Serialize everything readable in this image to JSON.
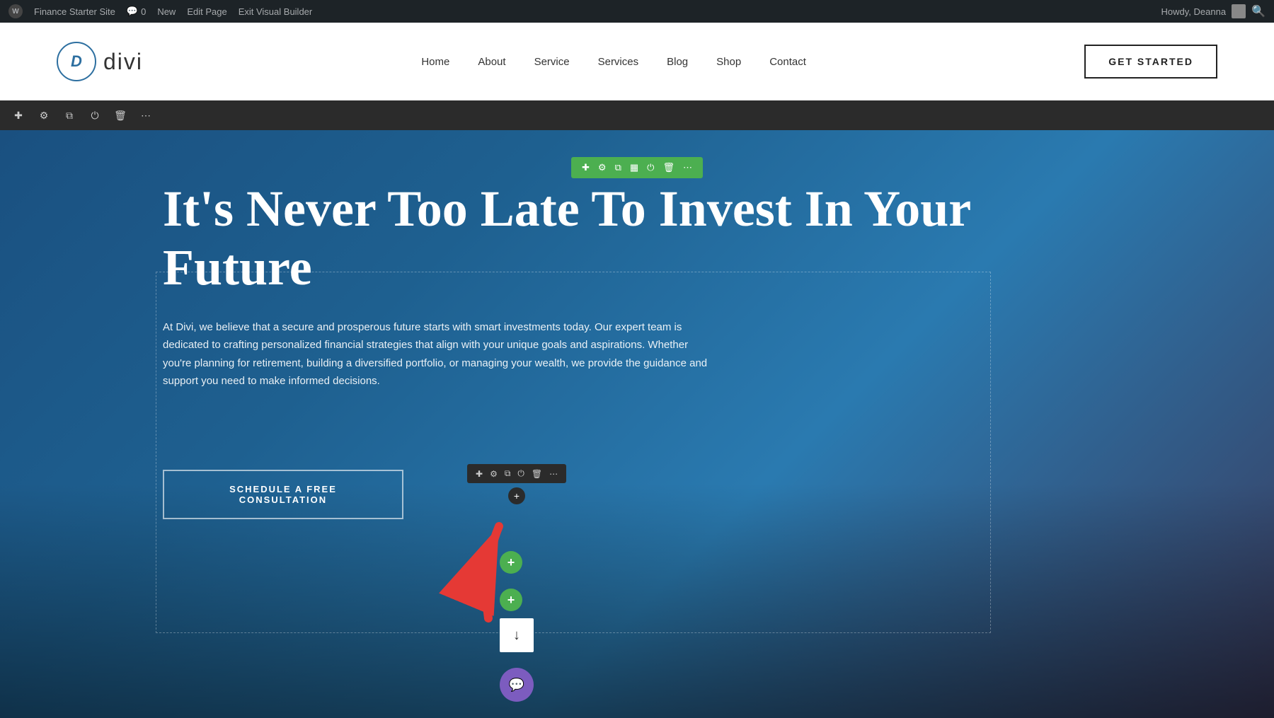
{
  "adminBar": {
    "siteName": "Finance Starter Site",
    "commentCount": "0",
    "newLabel": "New",
    "editPageLabel": "Edit Page",
    "exitBuilderLabel": "Exit Visual Builder",
    "howdyLabel": "Howdy, Deanna"
  },
  "header": {
    "logoLetter": "D",
    "logoText": "divi",
    "nav": {
      "items": [
        {
          "label": "Home"
        },
        {
          "label": "About"
        },
        {
          "label": "Service"
        },
        {
          "label": "Services"
        },
        {
          "label": "Blog"
        },
        {
          "label": "Shop"
        },
        {
          "label": "Contact"
        }
      ]
    },
    "ctaLabel": "GET STARTED"
  },
  "vbToolbar": {
    "icons": [
      "plus",
      "gear",
      "copy",
      "power",
      "trash",
      "ellipsis"
    ]
  },
  "hero": {
    "rowToolbarIcons": [
      "plus",
      "gear",
      "copy",
      "columns",
      "power",
      "trash",
      "ellipsis"
    ],
    "title": "It's Never Too Late To Invest In Your Future",
    "description": "At Divi, we believe that a secure and prosperous future starts with smart investments today. Our expert team is dedicated to crafting personalized financial strategies that align with your unique goals and aspirations. Whether you're planning for retirement, building a diversified portfolio, or managing your wealth, we provide the guidance and support you need to make informed decisions.",
    "ctaLabel": "SCHEDULE A FREE CONSULTATION"
  }
}
